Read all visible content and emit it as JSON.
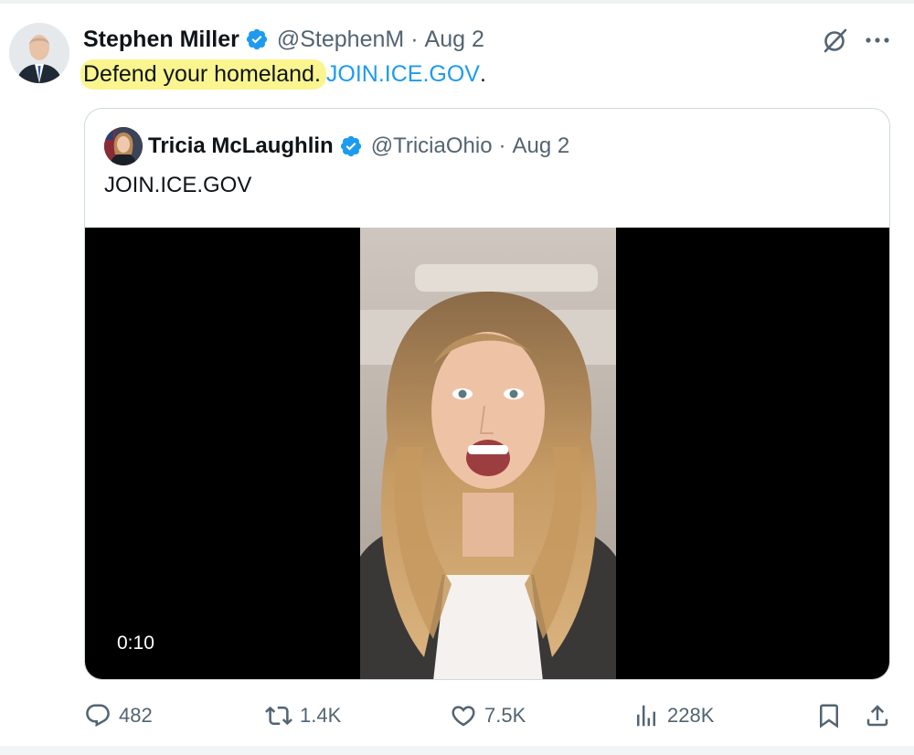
{
  "tweet": {
    "author_name": "Stephen Miller",
    "author_handle": "@StephenM",
    "separator": "·",
    "date": "Aug 2",
    "text_highlighted": "Defend your homeland.",
    "text_link": "JOIN.ICE.GOV",
    "text_suffix": ".",
    "highlight_color": "#fbf58f",
    "link_color": "#1d9bf0"
  },
  "quoted_tweet": {
    "author_name": "Tricia McLaughlin",
    "author_handle": "@TriciaOhio",
    "separator": "·",
    "date": "Aug 2",
    "text": "JOIN.ICE.GOV",
    "video_duration": "0:10"
  },
  "actions": {
    "replies": "482",
    "reposts": "1.4K",
    "likes": "7.5K",
    "views": "228K"
  },
  "icons": {
    "verified": "verified-badge-icon",
    "grok": "grok-icon",
    "more": "more-icon",
    "reply": "reply-icon",
    "retweet": "retweet-icon",
    "like": "heart-icon",
    "views": "views-chart-icon",
    "bookmark": "bookmark-icon",
    "share": "share-icon"
  },
  "colors": {
    "verified_blue": "#1d9bf0",
    "secondary_text": "#536471",
    "border": "#cfd9de"
  }
}
